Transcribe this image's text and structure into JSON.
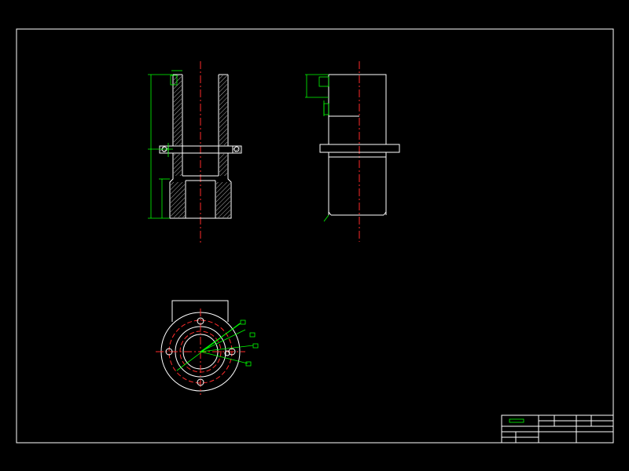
{
  "colors": {
    "background": "#000000",
    "outline": "#ffffff",
    "dimension": "#00ff00",
    "centerline": "#ff2a2a"
  },
  "title_block": {
    "name_cell": "",
    "cells": [
      "",
      "",
      "",
      "",
      ""
    ]
  }
}
